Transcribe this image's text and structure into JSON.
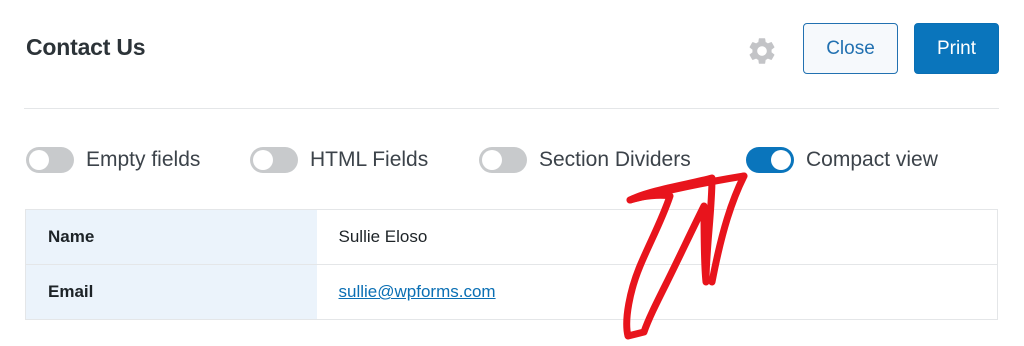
{
  "header": {
    "title": "Contact Us",
    "settings_icon": "gear-icon",
    "close_label": "Close",
    "print_label": "Print"
  },
  "toggles": [
    {
      "label": "Empty fields",
      "on": false
    },
    {
      "label": "HTML Fields",
      "on": false
    },
    {
      "label": "Section Dividers",
      "on": false
    },
    {
      "label": "Compact view",
      "on": true
    }
  ],
  "entry": {
    "rows": [
      {
        "name": "Name",
        "value": "Sullie Eloso"
      },
      {
        "name": "Email",
        "value": "sullie@wpforms.com"
      }
    ]
  },
  "colors": {
    "accent": "#0a75bc",
    "toggle_off": "#c8cacc",
    "label_bg": "#ebf3fb",
    "annotation_arrow": "#e8141c"
  }
}
